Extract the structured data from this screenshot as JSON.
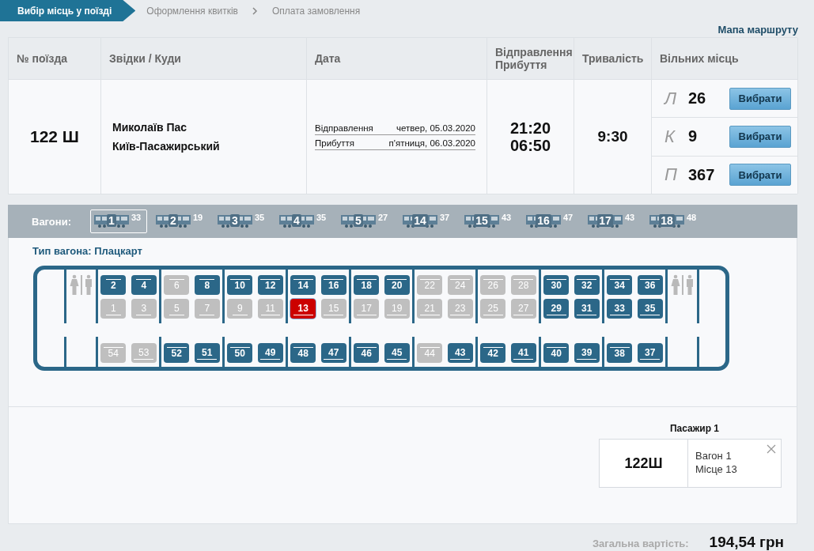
{
  "steps": [
    {
      "label": "Вибір місць у поїзді",
      "selected": true
    },
    {
      "label": "Оформлення квитків",
      "selected": false
    },
    {
      "label": "Оплата замовлення",
      "selected": false
    }
  ],
  "route_map_link": "Мапа маршруту",
  "table": {
    "columns": [
      "№ поїзда",
      "Звідки / Куди",
      "Дата",
      "Відправлення Прибуття",
      "Тривалість",
      "Вільних місць"
    ],
    "rows": [
      {
        "train": "122 Ш",
        "from": "Миколаїв Пас",
        "to": "Київ-Пасажирський",
        "dates": [
          {
            "label": "Відправлення",
            "value": "четвер, 05.03.2020"
          },
          {
            "label": "Прибуття",
            "value": "п'ятниця, 06.03.2020"
          }
        ],
        "departure_time": "21:20",
        "arrival_time": "06:50",
        "duration": "9:30",
        "classes": [
          {
            "letter": "Л",
            "free": "26",
            "button": "Вибрати"
          },
          {
            "letter": "К",
            "free": "9",
            "button": "Вибрати"
          },
          {
            "letter": "П",
            "free": "367",
            "button": "Вибрати"
          }
        ]
      }
    ]
  },
  "wagons_label": "Вагони:",
  "wagons": [
    {
      "number": "1",
      "free": "33",
      "selected": true
    },
    {
      "number": "2",
      "free": "19",
      "selected": false
    },
    {
      "number": "3",
      "free": "35",
      "selected": false
    },
    {
      "number": "4",
      "free": "35",
      "selected": false
    },
    {
      "number": "5",
      "free": "27",
      "selected": false
    },
    {
      "number": "14",
      "free": "37",
      "selected": false
    },
    {
      "number": "15",
      "free": "43",
      "selected": false
    },
    {
      "number": "16",
      "free": "47",
      "selected": false
    },
    {
      "number": "17",
      "free": "43",
      "selected": false
    },
    {
      "number": "18",
      "free": "48",
      "selected": false
    }
  ],
  "car_type": "Тип вагона: Плацкарт",
  "compartments": [
    {
      "upper": [
        {
          "number": "2",
          "available": true,
          "selected": false
        },
        {
          "number": "4",
          "available": true,
          "selected": false
        }
      ],
      "lower": [
        {
          "number": "1",
          "available": false,
          "selected": false
        },
        {
          "number": "3",
          "available": false,
          "selected": false
        }
      ],
      "side": [
        {
          "number": "54",
          "available": false,
          "selected": false
        },
        {
          "number": "53",
          "available": false,
          "selected": false
        }
      ]
    },
    {
      "upper": [
        {
          "number": "6",
          "available": false,
          "selected": false
        },
        {
          "number": "8",
          "available": true,
          "selected": false
        }
      ],
      "lower": [
        {
          "number": "5",
          "available": false,
          "selected": false
        },
        {
          "number": "7",
          "available": false,
          "selected": false
        }
      ],
      "side": [
        {
          "number": "52",
          "available": true,
          "selected": false
        },
        {
          "number": "51",
          "available": true,
          "selected": false
        }
      ]
    },
    {
      "upper": [
        {
          "number": "10",
          "available": true,
          "selected": false
        },
        {
          "number": "12",
          "available": true,
          "selected": false
        }
      ],
      "lower": [
        {
          "number": "9",
          "available": false,
          "selected": false
        },
        {
          "number": "11",
          "available": false,
          "selected": false
        }
      ],
      "side": [
        {
          "number": "50",
          "available": true,
          "selected": false
        },
        {
          "number": "49",
          "available": true,
          "selected": false
        }
      ]
    },
    {
      "upper": [
        {
          "number": "14",
          "available": true,
          "selected": false
        },
        {
          "number": "16",
          "available": true,
          "selected": false
        }
      ],
      "lower": [
        {
          "number": "13",
          "available": true,
          "selected": true
        },
        {
          "number": "15",
          "available": false,
          "selected": false
        }
      ],
      "side": [
        {
          "number": "48",
          "available": true,
          "selected": false
        },
        {
          "number": "47",
          "available": true,
          "selected": false
        }
      ]
    },
    {
      "upper": [
        {
          "number": "18",
          "available": true,
          "selected": false
        },
        {
          "number": "20",
          "available": true,
          "selected": false
        }
      ],
      "lower": [
        {
          "number": "17",
          "available": false,
          "selected": false
        },
        {
          "number": "19",
          "available": false,
          "selected": false
        }
      ],
      "side": [
        {
          "number": "46",
          "available": true,
          "selected": false
        },
        {
          "number": "45",
          "available": true,
          "selected": false
        }
      ]
    },
    {
      "upper": [
        {
          "number": "22",
          "available": false,
          "selected": false
        },
        {
          "number": "24",
          "available": false,
          "selected": false
        }
      ],
      "lower": [
        {
          "number": "21",
          "available": false,
          "selected": false
        },
        {
          "number": "23",
          "available": false,
          "selected": false
        }
      ],
      "side": [
        {
          "number": "44",
          "available": false,
          "selected": false
        },
        {
          "number": "43",
          "available": true,
          "selected": false
        }
      ]
    },
    {
      "upper": [
        {
          "number": "26",
          "available": false,
          "selected": false
        },
        {
          "number": "28",
          "available": false,
          "selected": false
        }
      ],
      "lower": [
        {
          "number": "25",
          "available": false,
          "selected": false
        },
        {
          "number": "27",
          "available": false,
          "selected": false
        }
      ],
      "side": [
        {
          "number": "42",
          "available": true,
          "selected": false
        },
        {
          "number": "41",
          "available": true,
          "selected": false
        }
      ]
    },
    {
      "upper": [
        {
          "number": "30",
          "available": true,
          "selected": false
        },
        {
          "number": "32",
          "available": true,
          "selected": false
        }
      ],
      "lower": [
        {
          "number": "29",
          "available": true,
          "selected": false
        },
        {
          "number": "31",
          "available": true,
          "selected": false
        }
      ],
      "side": [
        {
          "number": "40",
          "available": true,
          "selected": false
        },
        {
          "number": "39",
          "available": true,
          "selected": false
        }
      ]
    },
    {
      "upper": [
        {
          "number": "34",
          "available": true,
          "selected": false
        },
        {
          "number": "36",
          "available": true,
          "selected": false
        }
      ],
      "lower": [
        {
          "number": "33",
          "available": true,
          "selected": false
        },
        {
          "number": "35",
          "available": true,
          "selected": false
        }
      ],
      "side": [
        {
          "number": "38",
          "available": true,
          "selected": false
        },
        {
          "number": "37",
          "available": true,
          "selected": false
        }
      ]
    }
  ],
  "passenger": {
    "title": "Пасажир 1",
    "train": "122Ш",
    "lines": [
      "Вагон 1",
      "Місце 13"
    ]
  },
  "total": {
    "label": "Загальна вартість:",
    "value": "194,54 грн"
  }
}
